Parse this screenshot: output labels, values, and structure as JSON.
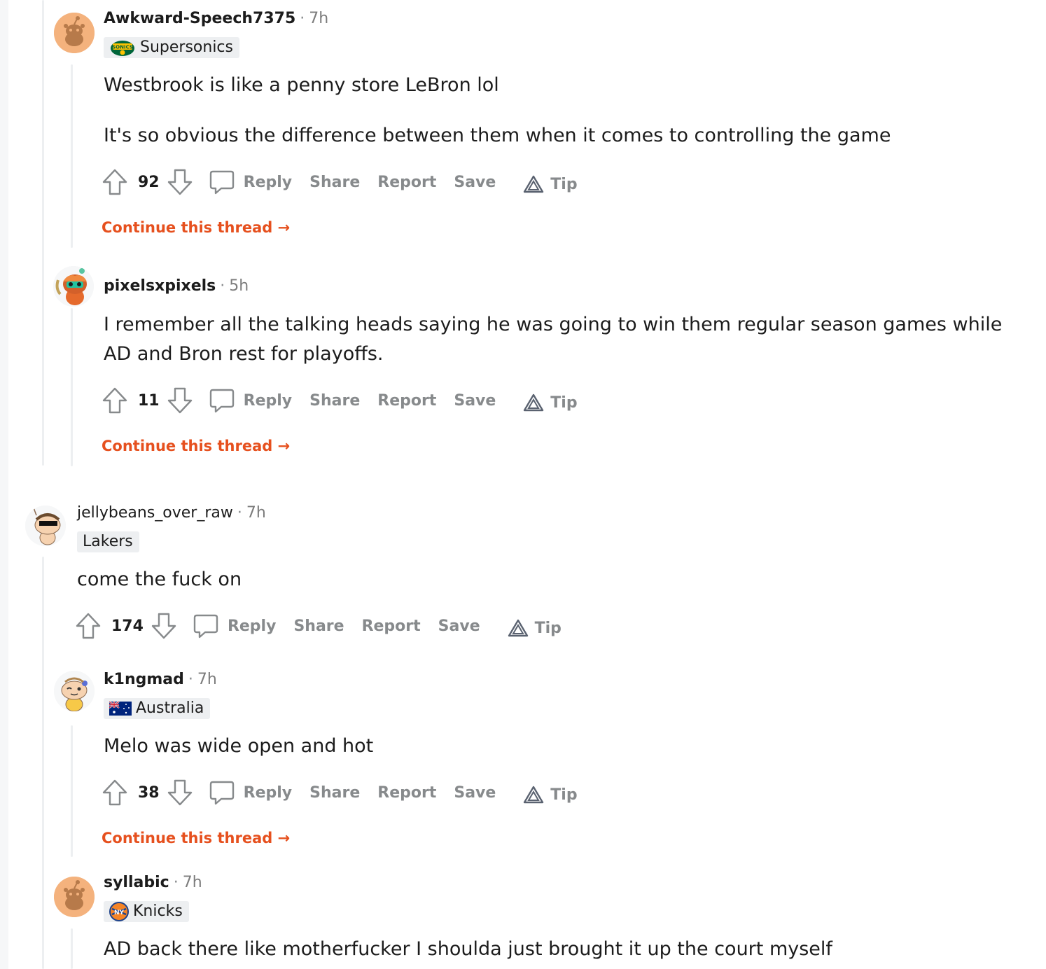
{
  "comments": [
    {
      "author": "Awkward-Speech7375",
      "time": "7h",
      "flair": "Supersonics",
      "flair_icon": "supersonics-logo",
      "body": [
        "Westbrook is like a penny store LeBron lol",
        "It's so obvious the difference between them when it comes to controlling the game"
      ],
      "score": "92",
      "continue": "Continue this thread"
    },
    {
      "author": "pixelsxpixels",
      "time": "5h",
      "flair": "",
      "body": [
        "I remember all the talking heads saying he was going to win them regular season games while AD and Bron rest for playoffs."
      ],
      "score": "11",
      "continue": "Continue this thread"
    },
    {
      "author": "jellybeans_over_raw",
      "time": "7h",
      "flair": "Lakers",
      "body": [
        "come the fuck on"
      ],
      "score": "174",
      "continue": ""
    },
    {
      "author": "k1ngmad",
      "time": "7h",
      "flair": "Australia",
      "flair_icon": "australia-flag",
      "body": [
        "Melo was wide open and hot"
      ],
      "score": "38",
      "continue": "Continue this thread"
    },
    {
      "author": "syllabic",
      "time": "7h",
      "flair": "Knicks",
      "flair_icon": "knicks-logo",
      "body": [
        "AD back there like motherfucker I shoulda just brought it up the court myself"
      ],
      "score": "",
      "continue": ""
    }
  ],
  "actions": {
    "reply": "Reply",
    "share": "Share",
    "report": "Report",
    "save": "Save",
    "tip": "Tip"
  },
  "separator": "·",
  "colors": {
    "accent": "#e6501e",
    "meta_gray": "#878a8c",
    "thread_line": "#edeff1",
    "flair_bg": "#edeff1"
  }
}
